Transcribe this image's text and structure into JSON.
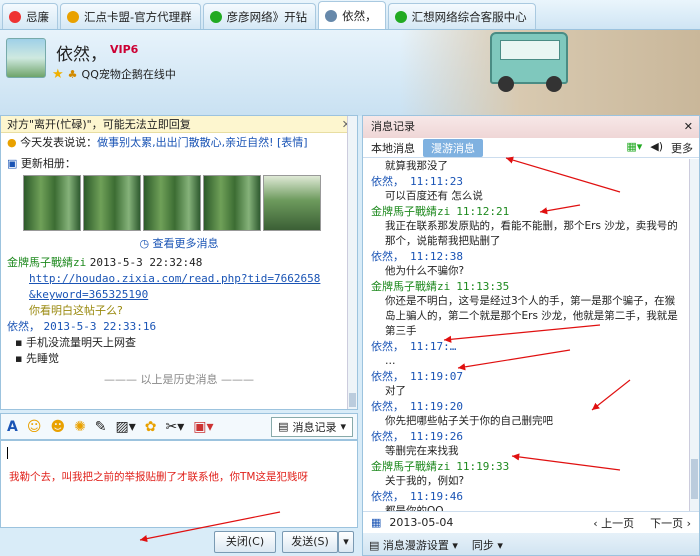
{
  "tabs": [
    {
      "label": "忌廉",
      "color": "#e33"
    },
    {
      "label": "汇点卡盟-官方代理群",
      "color": "#e9a100"
    },
    {
      "label": "彦彦网络》开钻",
      "color": "#2a2"
    },
    {
      "label": "依然，",
      "color": "#68a"
    },
    {
      "label": "汇想网络综合客服中心",
      "color": "#2a2"
    }
  ],
  "profile": {
    "nick": "依然，",
    "vip": "VIP6",
    "status": "QQ宠物企鹅在线中"
  },
  "left": {
    "notice": "对方\"离开(忙碌)\"，可能无法立即回复",
    "mood_prefix": "今天发表说说：",
    "mood_text": "做事别太累,出出门散散心,亲近自然!",
    "mood_tag": "[表情]",
    "album_title": "更新相册：",
    "more": "查看更多消息",
    "msg1_sender": "金牌馬子戰綪zi",
    "msg1_time": "2013-5-3 22:32:48",
    "msg1_link1": "http://houdao.zixia.com/read.php?tid=7662658",
    "msg1_link2": "&keyword=365325190",
    "msg1_q": "你看明白这帖子么?",
    "msg2_sender": "依然，",
    "msg2_time": "2013-5-3 22:33:16",
    "msg2_lines": [
      "手机没流量明天上网查",
      "先睡觉"
    ],
    "history": "以上是历史消息"
  },
  "input": {
    "typed": "我勒个去，叫我把之前的举报贴删了才联系他，你TM这是犯贱呀"
  },
  "buttons": {
    "record": "消息记录",
    "close": "关闭(C)",
    "send": "发送(S)"
  },
  "right": {
    "title": "消息记录",
    "tab_local": "本地消息",
    "tab_roam": "漫游消息",
    "more": "更多",
    "messages": [
      {
        "who": "",
        "cls": "b",
        "time": "",
        "text": "就算我那没了"
      },
      {
        "who": "依然，",
        "cls": "b",
        "time": "11:11:23",
        "text": "可以百度还有 怎么说"
      },
      {
        "who": "金牌馬子戰綪zi",
        "cls": "g",
        "time": "11:12:21",
        "text": "我正在联系那发原贴的，看能不能删，那个Ers 沙龙，卖我号的那个，说能帮我把贴删了"
      },
      {
        "who": "依然，",
        "cls": "b",
        "time": "11:12:38",
        "text": "他为什么不骗你?"
      },
      {
        "who": "金牌馬子戰綪zi",
        "cls": "g",
        "time": "11:13:35",
        "text": "你还是不明白，这号是经过3个人的手，第一是那个骗子，在猴岛上骗人的，第二个就是那个Ers 沙龙，他就是第二手，我就是第三手"
      },
      {
        "who": "依然，",
        "cls": "b",
        "time": "11:17:…",
        "text": "…"
      },
      {
        "who": "依然，",
        "cls": "b",
        "time": "11:19:07",
        "text": "对了"
      },
      {
        "who": "依然，",
        "cls": "b",
        "time": "11:19:20",
        "text": "你先把哪些帖子关于你的自己删完吧"
      },
      {
        "who": "依然，",
        "cls": "b",
        "time": "11:19:26",
        "text": "等删完在来找我"
      },
      {
        "who": "金牌馬子戰綪zi",
        "cls": "g",
        "time": "11:19:33",
        "text": "关于我的，例如?"
      },
      {
        "who": "依然，",
        "cls": "b",
        "time": "11:19:46",
        "text": "都是你的QQ"
      }
    ],
    "date": "2013-05-04",
    "prev": "上一页",
    "next": "下一页",
    "foot_setting": "消息漫游设置",
    "foot_sync": "同步"
  }
}
